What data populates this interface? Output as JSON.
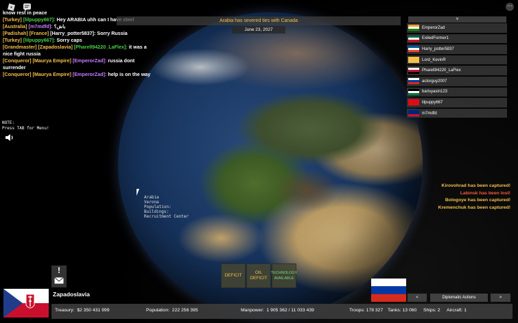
{
  "game": {
    "top_banner": "Arabia has severed ties with Canada",
    "date": "June 23, 2027",
    "note_line1": "NOTE:",
    "note_line2": "Press TAB for Menu!",
    "player_list_toggle": "v"
  },
  "chat": [
    {
      "segments": [
        {
          "text": "know rest in peace",
          "color": "#ffffff"
        }
      ]
    },
    {
      "segments": [
        {
          "text": "[Turkey] ",
          "color": "#f4c04a"
        },
        {
          "text": "[lilpuppy667]:",
          "color": "#4ad14a"
        },
        {
          "text": " Hey ARABIA uhh can I have steel",
          "color": "#ffffff"
        }
      ]
    },
    {
      "segments": [
        {
          "text": "[Australia] ",
          "color": "#f4c04a"
        },
        {
          "text": "[m7mdfd]:",
          "color": "#c77dff"
        },
        {
          "text": " باش؟",
          "color": "#ffffff"
        }
      ]
    },
    {
      "segments": [
        {
          "text": "[Padishah] ",
          "color": "#f4c04a"
        },
        {
          "text": "[France] ",
          "color": "#f4c04a"
        },
        {
          "text": "[Harry_potter5837]:",
          "color": "#ffffff"
        },
        {
          "text": " Sorry Russia",
          "color": "#ffffff"
        }
      ]
    },
    {
      "segments": [
        {
          "text": "[Turkey] ",
          "color": "#f4c04a"
        },
        {
          "text": "[lilpuppy667]:",
          "color": "#4ad14a"
        },
        {
          "text": " Sorry caps",
          "color": "#ffffff"
        }
      ]
    },
    {
      "segments": [
        {
          "text": "[Grandmaster] ",
          "color": "#f4c04a"
        },
        {
          "text": "[Zapadoslavia] ",
          "color": "#f4c04a"
        },
        {
          "text": "[Pharell94220_LaFlex]:",
          "color": "#4ad14a"
        },
        {
          "text": " it was a nice fight russia",
          "color": "#ffffff"
        }
      ]
    },
    {
      "segments": [
        {
          "text": "[Conqueror] ",
          "color": "#f4c04a"
        },
        {
          "text": "[Maurya Empire] ",
          "color": "#f4c04a"
        },
        {
          "text": "[EmperorZad]:",
          "color": "#c77dff"
        },
        {
          "text": " russia dont surrender",
          "color": "#ffffff"
        }
      ]
    },
    {
      "segments": [
        {
          "text": "[Conqueror] ",
          "color": "#f4c04a"
        },
        {
          "text": "[Maurya Empire] ",
          "color": "#f4c04a"
        },
        {
          "text": "[EmperorZad]:",
          "color": "#c77dff"
        },
        {
          "text": " help is on the way",
          "color": "#ffffff"
        }
      ]
    }
  ],
  "players": [
    {
      "name": "EmperorZad",
      "flag": [
        "#ff9933",
        "#ffffff",
        "#138808"
      ]
    },
    {
      "name": "ExiledFormer1",
      "flag": [
        "#006847",
        "#ffffff",
        "#ce1126"
      ]
    },
    {
      "name": "Harry_potter5837",
      "flag": [
        "#0055a4",
        "#ffffff",
        "#ef4135"
      ]
    },
    {
      "name": "Lord_KevinR",
      "flag": [
        "#f4c04a",
        "#f4c04a",
        "#f4c04a"
      ]
    },
    {
      "name": "Pharell94220_LaFlex",
      "flag": [
        "#ffffff",
        "#c8102e",
        "#000000"
      ]
    },
    {
      "name": "actorguy2007",
      "flag": [
        "#ffffff",
        "#0039a6",
        "#d52b1e"
      ]
    },
    {
      "name": "barisyasin123",
      "flag": [
        "#000000",
        "#ffffff",
        "#007a3d"
      ]
    },
    {
      "name": "lilpuppy667",
      "flag": [
        "#e30a17",
        "#e30a17",
        "#e30a17"
      ]
    },
    {
      "name": "m7mdfd",
      "flag": [
        "#00247d",
        "#00247d",
        "#cf142b"
      ]
    }
  ],
  "events": [
    {
      "text": "Kirovohrad has been captured!",
      "color": "#f4c04a"
    },
    {
      "text": "Labinsk has been lost!",
      "color": "#ff5a3c"
    },
    {
      "text": "Bologoye has been captured!",
      "color": "#f4c04a"
    },
    {
      "text": "Kremenchuk has been captured!",
      "color": "#f4c04a"
    }
  ],
  "city_info": [
    "Arabia",
    "Verona",
    "Population:",
    "Buildings:",
    "Recruitment Center"
  ],
  "alerts": {
    "deficit": "DEFICIT",
    "oil_line1": "OIL",
    "oil_line2": "DEFICIT",
    "tech_line1": "TECHNOLOGY",
    "tech_line2": "AVAILABLE"
  },
  "country": {
    "name": "Zapadoslavia",
    "mail_icon": "mail-icon"
  },
  "stats": {
    "treasury_label": "Treasury:",
    "treasury_value": "$2 350 431 999",
    "population_label": "Population:",
    "population_value": "222 256 395",
    "manpower_label": "Manpower:",
    "manpower_value": "1 905 362  /  11 033 439",
    "troops": "Troops: 178 327",
    "tanks": "Tanks: 13 060",
    "ships": "Ships: 2",
    "aircraft": "Aircraft: 1"
  },
  "diplomacy": {
    "prev": "<",
    "label": "Diplomatic Actions",
    "next": ">"
  },
  "colors": {
    "accent": "#f4c04a",
    "panel": "#3c3c3c"
  }
}
